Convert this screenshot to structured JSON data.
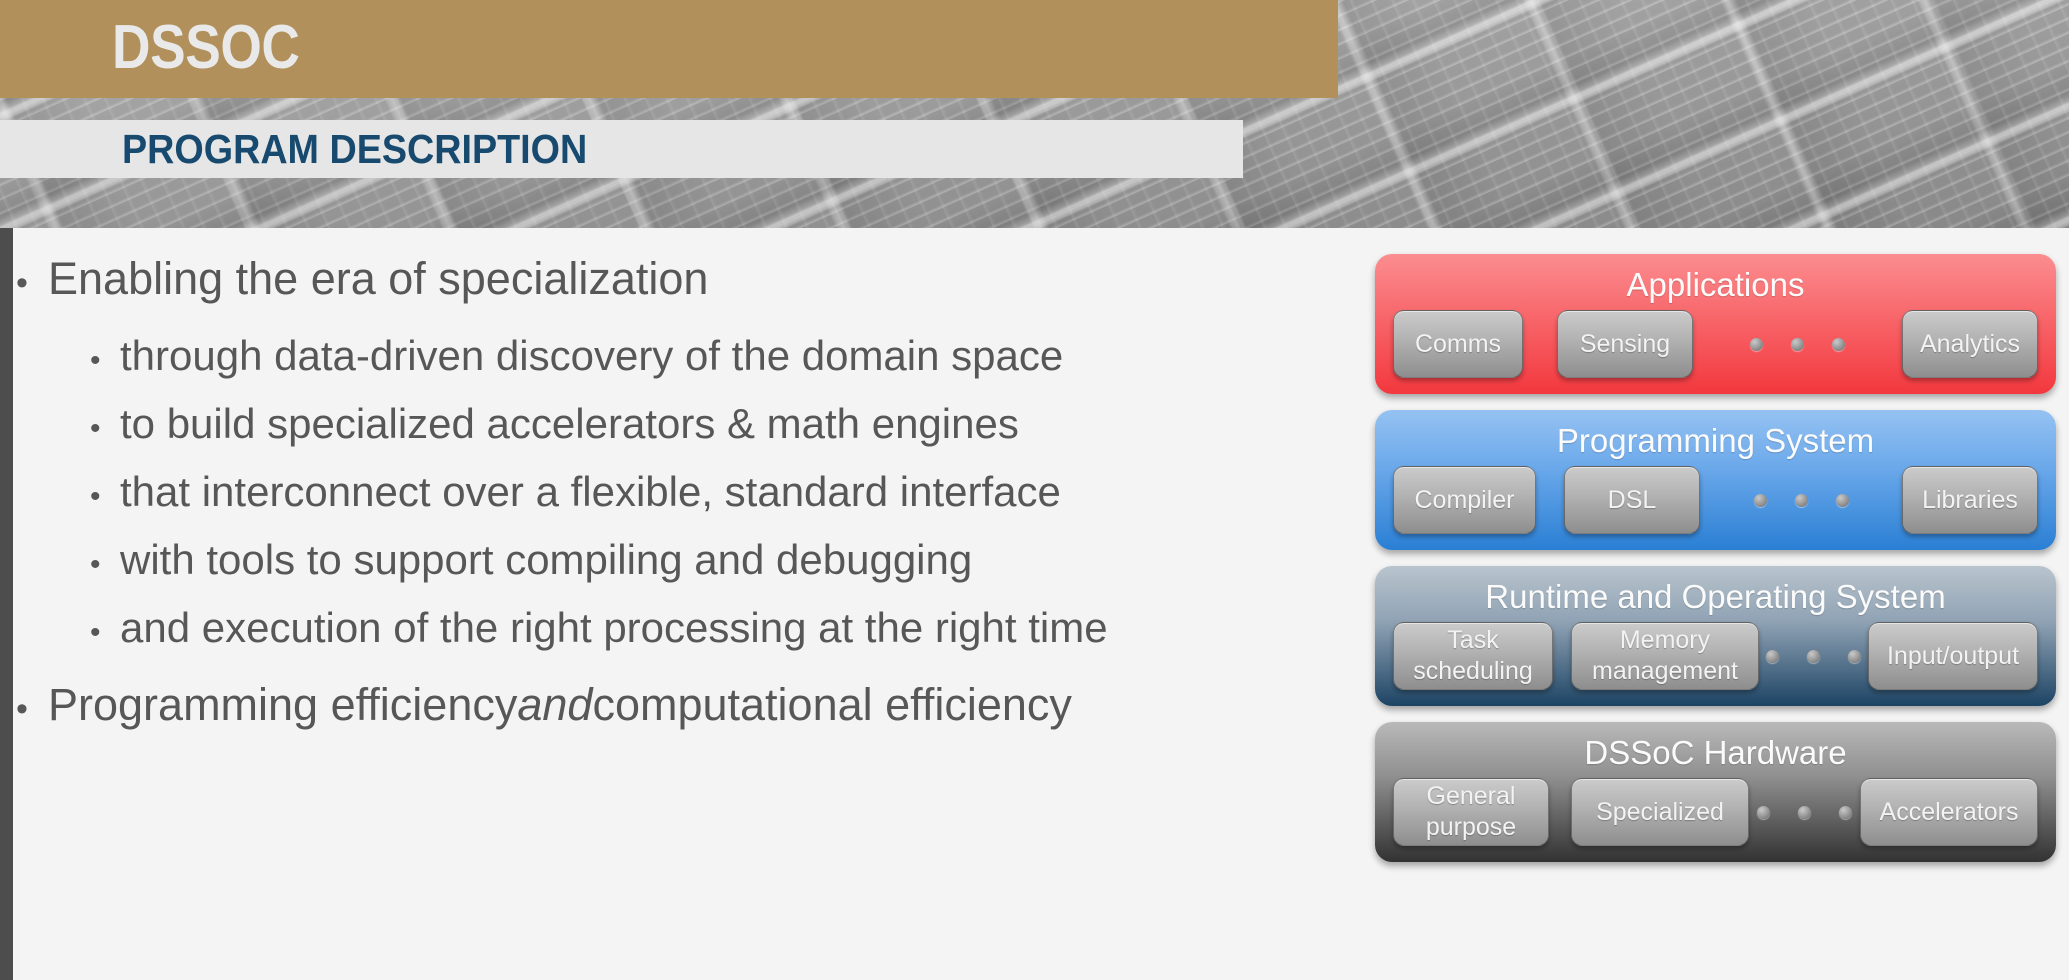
{
  "header": {
    "program_title": "DSSOC",
    "section_title": "PROGRAM DESCRIPTION",
    "title_bar_color": "#b1905c",
    "section_bar_color": "#e6e6e6",
    "section_text_color": "#174a6e"
  },
  "bullets": [
    {
      "level": 1,
      "marker": "•",
      "text": "Enabling the era of specialization"
    },
    {
      "level": 2,
      "marker": "•",
      "text": "through data-driven discovery of the domain space"
    },
    {
      "level": 2,
      "marker": "•",
      "text": "to build specialized accelerators & math engines"
    },
    {
      "level": 2,
      "marker": "•",
      "text": "that interconnect over a flexible, standard interface"
    },
    {
      "level": 2,
      "marker": "•",
      "text": "with tools to support compiling and debugging"
    },
    {
      "level": 2,
      "marker": "•",
      "text": "and execution of the right processing at the right time"
    }
  ],
  "final_bullet": {
    "marker": "•",
    "part1": "Programming efficiency ",
    "emphasis": "and",
    "part2": " computational efficiency"
  },
  "stack": {
    "layers": [
      {
        "id": "applications",
        "title": "Applications",
        "color": "#f2383e",
        "chips": [
          "Comms",
          "Sensing",
          "Analytics"
        ]
      },
      {
        "id": "programming-system",
        "title": "Programming System",
        "color": "#2a7fd4",
        "chips": [
          "Compiler",
          "DSL",
          "Libraries"
        ]
      },
      {
        "id": "runtime-and-operating-system",
        "title": "Runtime and Operating System",
        "color": "#1d4464",
        "chips": [
          "Task\nscheduling",
          "Memory\nmanagement",
          "Input/output"
        ]
      },
      {
        "id": "dssoc-hardware",
        "title": "DSSoC Hardware",
        "color": "#323232",
        "chips": [
          "General\npurpose",
          "Specialized",
          "Accelerators"
        ]
      }
    ],
    "ellipsis_dot_count": 3
  }
}
